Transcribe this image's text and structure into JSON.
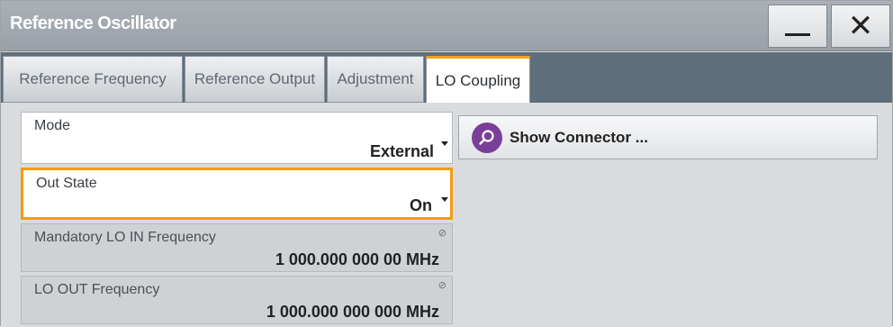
{
  "window": {
    "title": "Reference Oscillator",
    "minimize_icon": "minimize-icon",
    "close_icon": "close-icon"
  },
  "tabs": [
    {
      "label": "Reference Frequency",
      "active": false
    },
    {
      "label": "Reference Output",
      "active": false
    },
    {
      "label": "Adjustment",
      "active": false
    },
    {
      "label": "LO Coupling",
      "active": true
    }
  ],
  "mode": {
    "label": "Mode",
    "value": "External"
  },
  "out_state": {
    "label": "Out State",
    "value": "On"
  },
  "lo_in": {
    "label": "Mandatory LO IN Frequency",
    "value": "1 000.000 000 00 MHz"
  },
  "lo_out": {
    "label": "LO OUT Frequency",
    "value": "1 000.000 000 000 MHz"
  },
  "show_connector": {
    "label": "Show Connector ...",
    "icon": "search-icon"
  },
  "colors": {
    "accent": "#f29c12",
    "tab_strip": "#5e6f7b",
    "connector_icon": "#7a3f98"
  }
}
